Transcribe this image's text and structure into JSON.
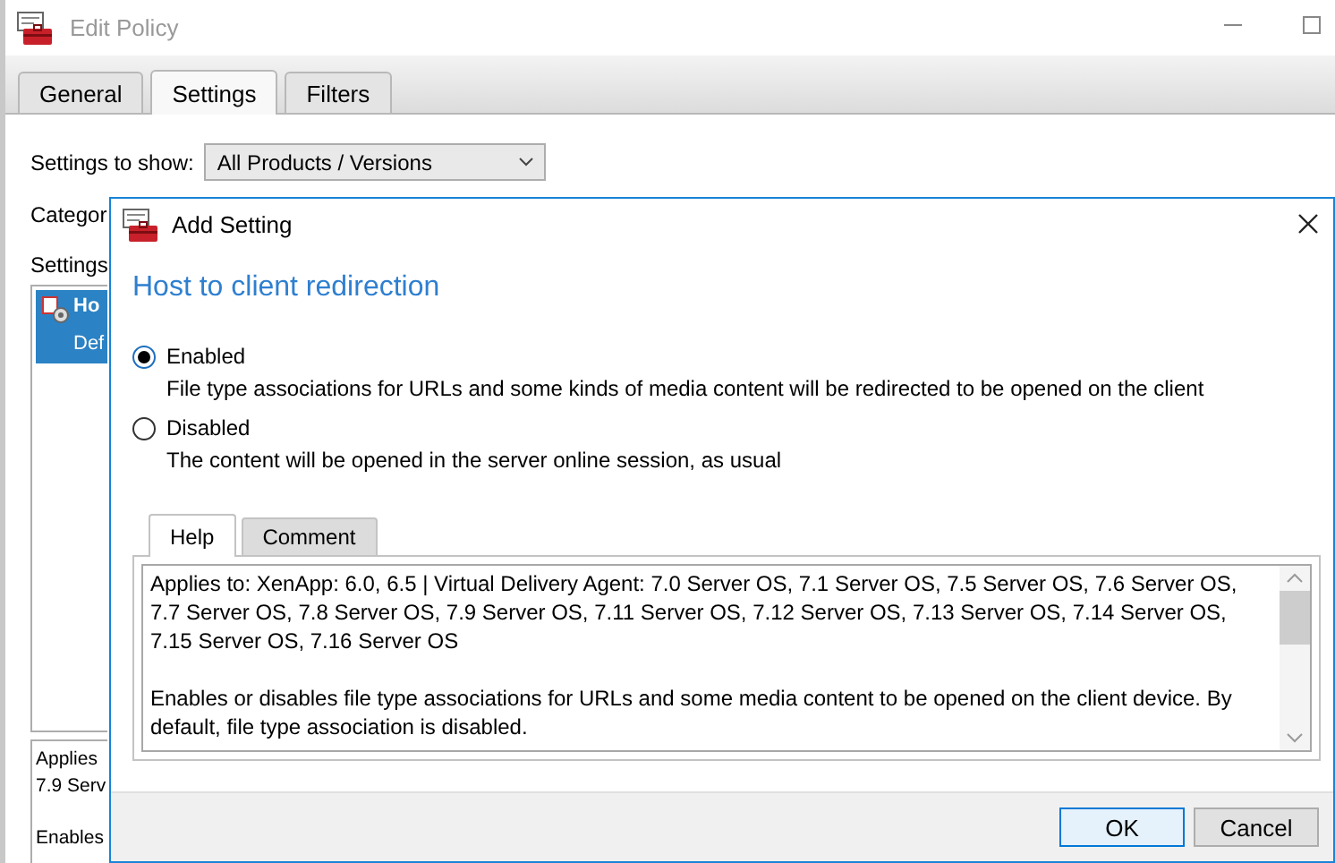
{
  "window": {
    "title": "Edit Policy"
  },
  "tabs": [
    {
      "label": "General",
      "selected": false
    },
    {
      "label": "Settings",
      "selected": true
    },
    {
      "label": "Filters",
      "selected": false
    }
  ],
  "settings_to_show": {
    "label": "Settings to show:",
    "value": "All Products / Versions"
  },
  "category_label": "Categor",
  "settings_label": "Settings",
  "settings_list": [
    {
      "title": "Ho",
      "subtitle": "Def",
      "selected": true
    }
  ],
  "description_box": {
    "paragraphs": [
      "Applies\n7.9 Serv",
      "Enables"
    ]
  },
  "dialog": {
    "title": "Add Setting",
    "heading": "Host to client redirection",
    "options": [
      {
        "label": "Enabled",
        "description": "File type associations for URLs and some kinds of media content will be redirected to be opened on the client",
        "selected": true
      },
      {
        "label": "Disabled",
        "description": "The content will be opened in the server online session, as usual",
        "selected": false
      }
    ],
    "tabs": [
      {
        "label": "Help",
        "selected": true
      },
      {
        "label": "Comment",
        "selected": false
      }
    ],
    "help_text": [
      "Applies to: XenApp: 6.0, 6.5 | Virtual Delivery Agent: 7.0 Server OS, 7.1 Server OS, 7.5 Server OS, 7.6 Server OS, 7.7 Server OS, 7.8 Server OS, 7.9 Server OS, 7.11 Server OS, 7.12 Server OS, 7.13 Server OS, 7.14 Server OS, 7.15 Server OS, 7.16 Server OS",
      "Enables or disables file type associations for URLs and some media content to be opened on the client device. By default, file type association is disabled."
    ],
    "buttons": [
      {
        "label": "OK",
        "default": true
      },
      {
        "label": "Cancel",
        "default": false
      }
    ]
  }
}
